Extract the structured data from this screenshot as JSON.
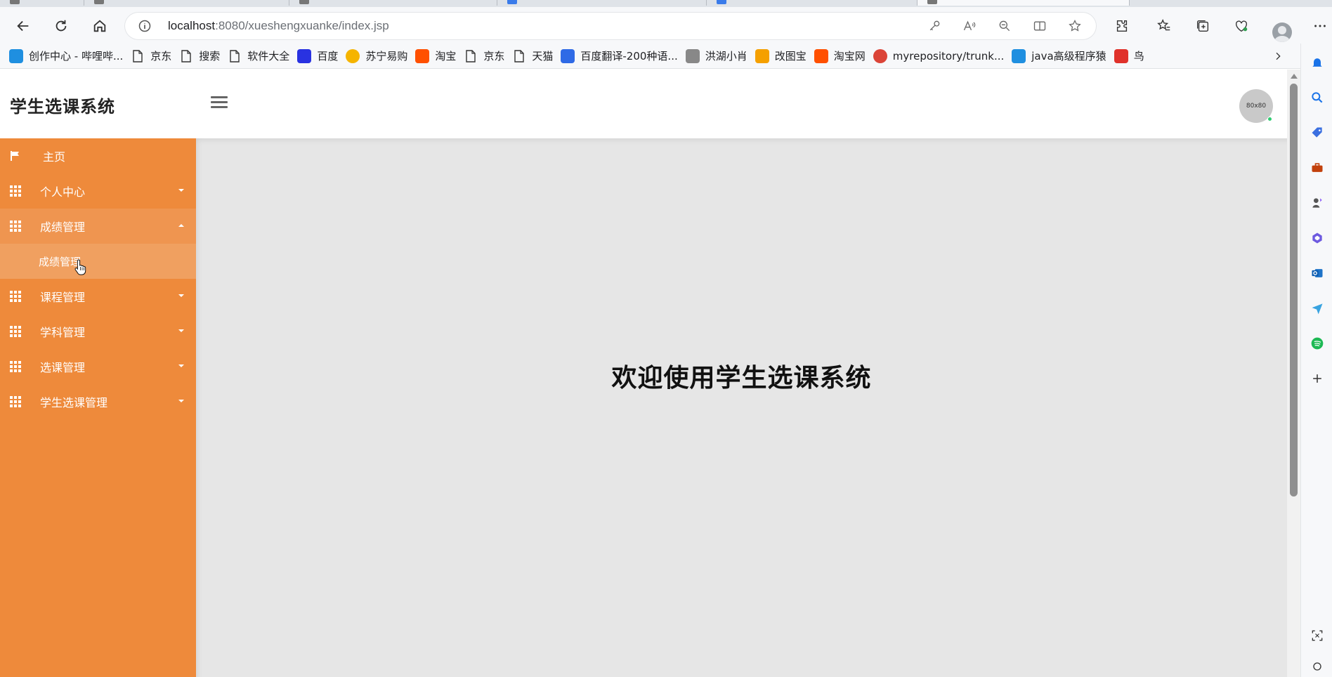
{
  "browser": {
    "url_host": "localhost",
    "url_path": ":8080/xueshengxuanke/index.jsp",
    "bookmarks": [
      {
        "label": "创作中心 - 哔哩哔...",
        "icon": "bilibili-icon",
        "color": "#1f8fe0"
      },
      {
        "label": "京东",
        "icon": "page-icon",
        "color": ""
      },
      {
        "label": "搜索",
        "icon": "page-icon",
        "color": ""
      },
      {
        "label": "软件大全",
        "icon": "page-icon",
        "color": ""
      },
      {
        "label": "百度",
        "icon": "baidu-paw-icon",
        "color": "#2932e1"
      },
      {
        "label": "苏宁易购",
        "icon": "suning-icon",
        "color": "#f5b400"
      },
      {
        "label": "淘宝",
        "icon": "taobao-icon",
        "color": "#ff5000"
      },
      {
        "label": "京东",
        "icon": "page-icon",
        "color": ""
      },
      {
        "label": "天猫",
        "icon": "page-icon",
        "color": ""
      },
      {
        "label": "百度翻译-200种语...",
        "icon": "baidu-translate-icon",
        "color": "#2f6ae6"
      },
      {
        "label": "洪湖小肖",
        "icon": "bird-icon",
        "color": "#888888"
      },
      {
        "label": "改图宝",
        "icon": "gaitubao-icon",
        "color": "#f5a000"
      },
      {
        "label": "淘宝网",
        "icon": "taobao-icon",
        "color": "#ff5000"
      },
      {
        "label": "myrepository/trunk...",
        "icon": "chrome-icon",
        "color": "#db4437"
      },
      {
        "label": "java高级程序猿",
        "icon": "bilibili-icon",
        "color": "#1f8fe0"
      },
      {
        "label": "鸟",
        "icon": "red-bird-icon",
        "color": "#e0322b"
      }
    ]
  },
  "app": {
    "brand": "学生选课系统",
    "avatar_text": "80x80",
    "welcome": "欢迎使用学生选课系统",
    "nav": [
      {
        "label": "主页",
        "icon": "flag-icon"
      },
      {
        "label": "个人中心",
        "icon": "grid-icon"
      },
      {
        "label": "成绩管理",
        "icon": "grid-icon"
      },
      {
        "label": "课程管理",
        "icon": "grid-icon"
      },
      {
        "label": "学科管理",
        "icon": "grid-icon"
      },
      {
        "label": "选课管理",
        "icon": "grid-icon"
      },
      {
        "label": "学生选课管理",
        "icon": "grid-icon"
      }
    ],
    "submenu": {
      "label": "成绩管理"
    },
    "colors": {
      "sidebar": "#ee8a3b",
      "sidebar_open": "#ef9550",
      "submenu": "#f0a060",
      "content_bg": "#e6e6e6"
    }
  }
}
